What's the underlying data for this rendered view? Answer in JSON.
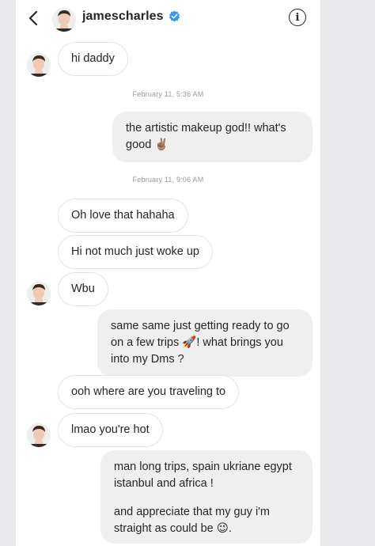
{
  "header": {
    "username": "jamescharles",
    "back_icon": "chevron-left-icon",
    "info_icon": "info-icon",
    "info_glyph": "i",
    "verified_icon": "verified-badge-icon",
    "colors": {
      "verified": "#3897f0",
      "text": "#262626"
    }
  },
  "messages": {
    "m1": "hi daddy",
    "ts1": "February 11, 5:36 AM",
    "m2_line1": "the artistic makeup god!! what's",
    "m2_line2": "good ✌🏽",
    "ts2": "February 11, 9:06 AM",
    "m3": "Oh love that hahaha",
    "m4": "Hi not much just woke up",
    "m5": "Wbu",
    "m6_line1": "same same just getting ready to go",
    "m6_line2": "on a few trips 🚀! what brings you",
    "m6_line3": "into my Dms ?",
    "m7": "ooh where are you traveling to",
    "m8": "lmao you're hot",
    "m9_line1": "man long trips, spain ukriane egypt",
    "m9_line2": "istanbul and africa !",
    "m9_line3": "and appreciate that my guy i'm",
    "m9_line4": "straight as could be 😉."
  }
}
